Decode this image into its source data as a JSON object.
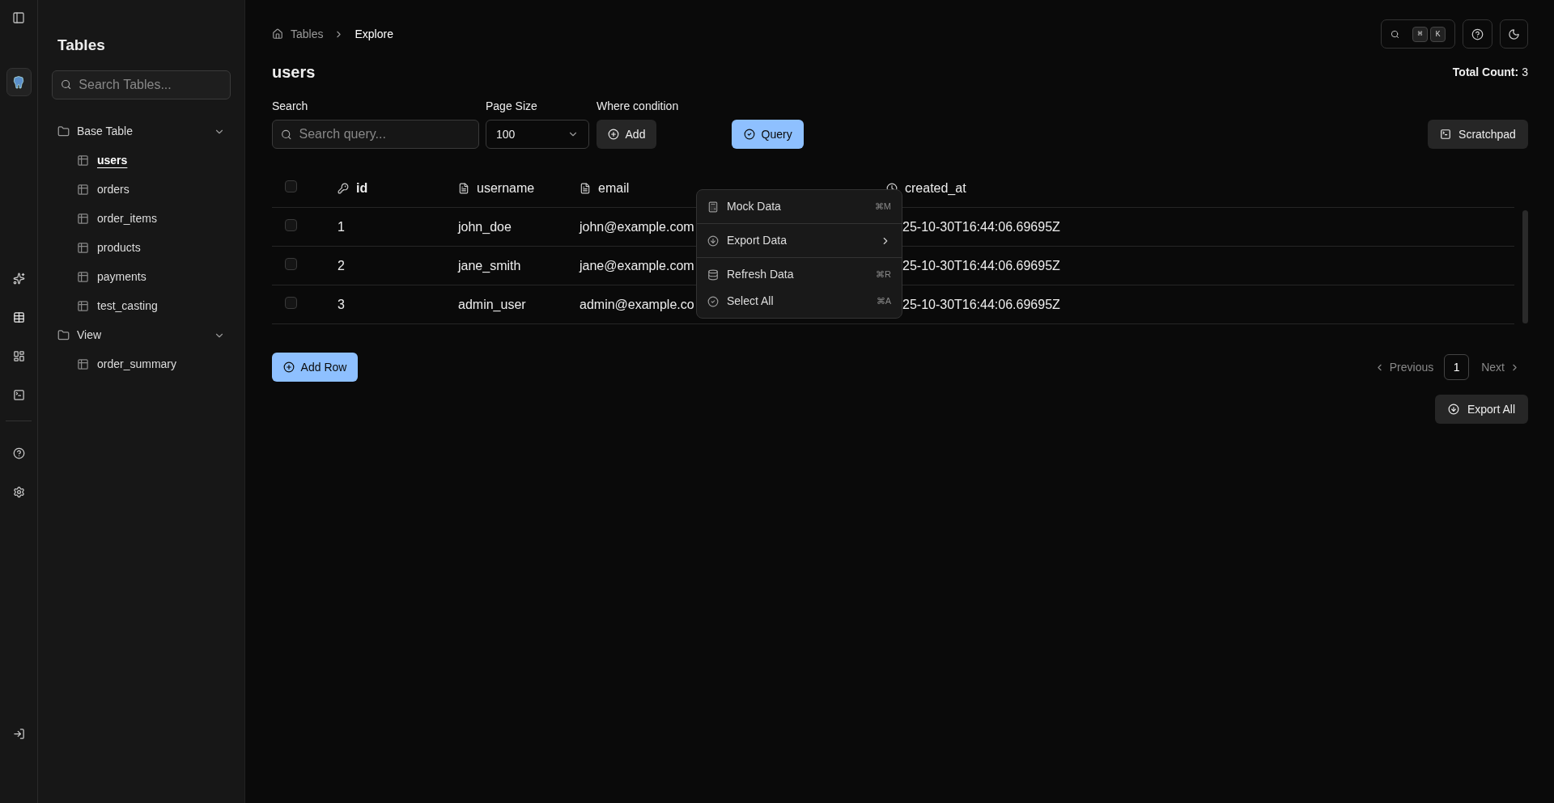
{
  "sidebar": {
    "title": "Tables",
    "search": {
      "placeholder": "Search Tables..."
    },
    "groups": [
      {
        "label": "Base Table",
        "expanded": true,
        "children": [
          {
            "label": "users",
            "selected": true
          },
          {
            "label": "orders",
            "selected": false
          },
          {
            "label": "order_items",
            "selected": false
          },
          {
            "label": "products",
            "selected": false
          },
          {
            "label": "payments",
            "selected": false
          },
          {
            "label": "test_casting",
            "selected": false
          }
        ]
      },
      {
        "label": "View",
        "expanded": true,
        "children": [
          {
            "label": "order_summary",
            "selected": false
          }
        ]
      }
    ]
  },
  "breadcrumb": [
    "Tables",
    "Explore"
  ],
  "toolbar": {
    "shortcut_keys": [
      "⌘",
      "K"
    ]
  },
  "page": {
    "title": "users",
    "total_count_label": "Total Count:",
    "total_count": "3"
  },
  "filters": {
    "search": {
      "label": "Search",
      "placeholder": "Search query..."
    },
    "page_size": {
      "label": "Page Size",
      "value": "100"
    },
    "where": {
      "label": "Where condition",
      "button": "Add"
    },
    "query_button": "Query",
    "scratchpad_button": "Scratchpad"
  },
  "table": {
    "header_checked": false,
    "columns": [
      {
        "label": "id",
        "kind": "key"
      },
      {
        "label": "username",
        "kind": "text"
      },
      {
        "label": "email",
        "kind": "text"
      },
      {
        "kind": "covered"
      },
      {
        "label": "created_at",
        "kind": "time"
      }
    ],
    "rows": [
      {
        "checked": false,
        "cells": [
          "1",
          "john_doe",
          "john@example.com",
          "25-10-30T16:44:06.69695Z"
        ]
      },
      {
        "checked": false,
        "cells": [
          "2",
          "jane_smith",
          "jane@example.com",
          "25-10-30T16:44:06.69695Z"
        ]
      },
      {
        "checked": false,
        "cells": [
          "3",
          "admin_user",
          "admin@example.co",
          "25-10-30T16:44:06.69695Z"
        ]
      }
    ]
  },
  "context_menu": {
    "items": [
      {
        "label": "Mock Data",
        "kind": "mock",
        "shortcut": "⌘M",
        "separator_after": true
      },
      {
        "label": "Export Data",
        "kind": "submenu",
        "separator_after": true
      },
      {
        "label": "Refresh Data",
        "kind": "refresh",
        "shortcut": "⌘R",
        "separator_after": false
      },
      {
        "label": "Select All",
        "kind": "select",
        "shortcut": "⌘A",
        "separator_after": false
      }
    ]
  },
  "add_row_button": "Add Row",
  "pagination": {
    "previous": "Previous",
    "pages": [
      {
        "label": "1",
        "selected": true
      }
    ],
    "next": "Next"
  },
  "export_all_button": "Export All"
}
